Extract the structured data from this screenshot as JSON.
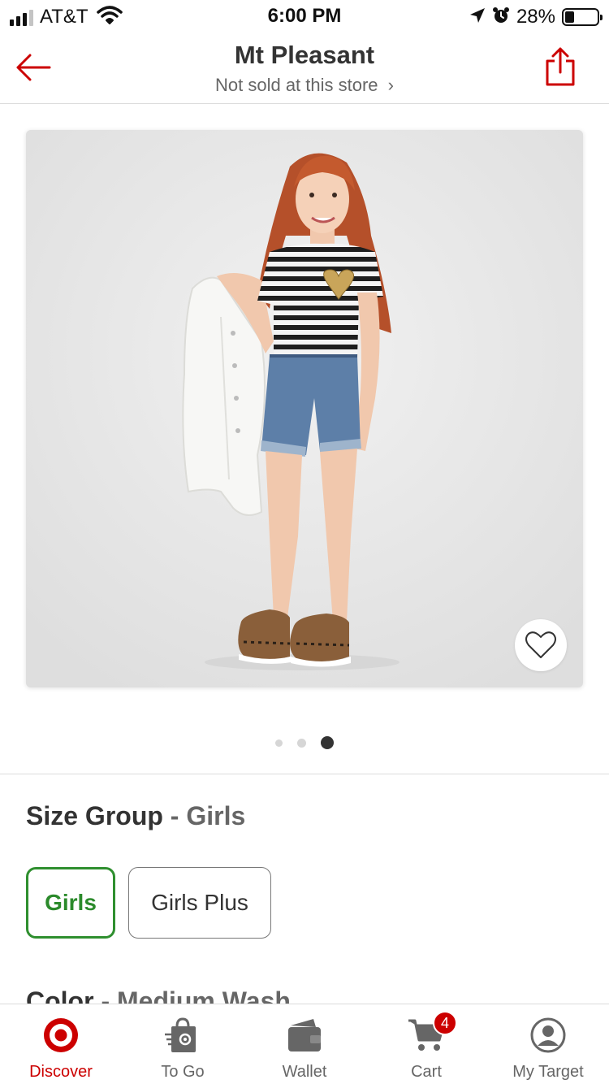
{
  "status_bar": {
    "carrier": "AT&T",
    "time": "6:00 PM",
    "battery_percent": "28%",
    "battery_level": 0.28,
    "icons": [
      "signal-icon",
      "wifi-icon",
      "location-arrow-icon",
      "alarm-icon",
      "battery-icon"
    ]
  },
  "header": {
    "store_name": "Mt Pleasant",
    "store_status": "Not sold at this store",
    "chevron": "›",
    "back_icon": "back-arrow-icon",
    "share_icon": "share-icon"
  },
  "gallery": {
    "image_alt": "Girl in striped t-shirt and denim shorts holding a white jacket",
    "dots_total": 3,
    "active_index": 2,
    "favorite_icon": "heart-icon"
  },
  "size_group": {
    "label": "Size Group",
    "separator": " - ",
    "selected": "Girls",
    "options": [
      "Girls",
      "Girls Plus"
    ]
  },
  "next_section_partial": {
    "label": "Color",
    "separator": " - ",
    "selected": "Medium Wash"
  },
  "tab_bar": {
    "tabs": [
      {
        "label": "Discover",
        "icon": "target-logo-icon",
        "active": true
      },
      {
        "label": "To Go",
        "icon": "shopping-bag-icon",
        "active": false
      },
      {
        "label": "Wallet",
        "icon": "wallet-icon",
        "active": false
      },
      {
        "label": "Cart",
        "icon": "cart-icon",
        "active": false,
        "badge": "4"
      },
      {
        "label": "My Target",
        "icon": "profile-icon",
        "active": false
      }
    ]
  },
  "colors": {
    "brand_red": "#cc0000",
    "selected_green": "#2b8a2b",
    "text_dark": "#333333",
    "text_muted": "#666666"
  }
}
